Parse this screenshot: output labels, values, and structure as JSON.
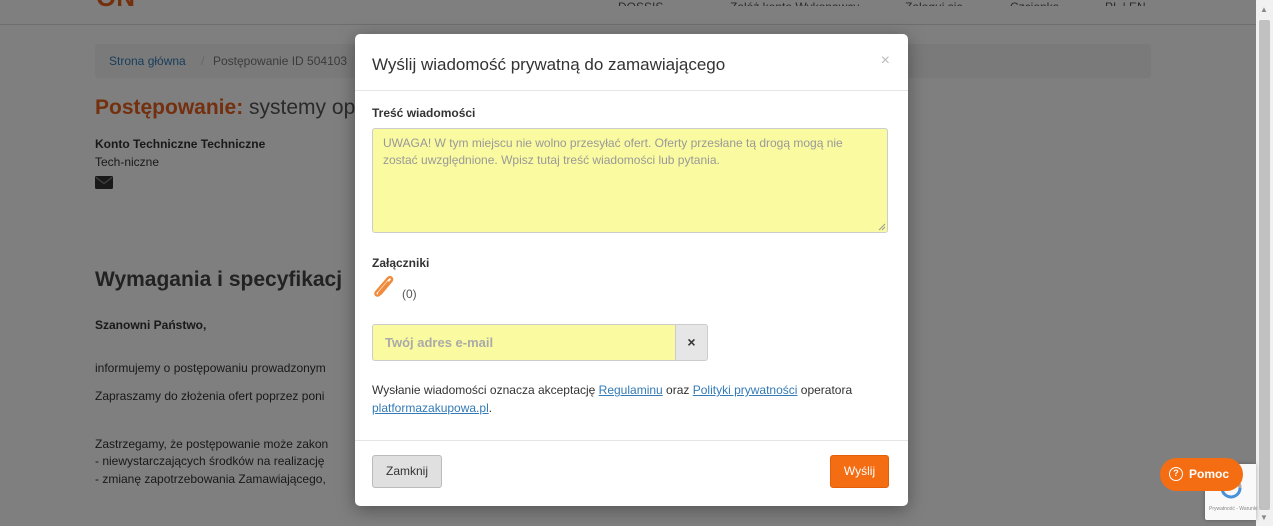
{
  "background": {
    "logo": "ON",
    "nav": [
      "DOSSIS",
      "Załóż konto Wykonawcy",
      "Zaloguj się",
      "Czcionka",
      "PL | EN"
    ],
    "breadcrumb": {
      "home": "Strona główna",
      "separator": "/",
      "current": "Postępowanie ID 504103"
    },
    "title_label": "Postępowanie:",
    "title_value": "systemy op",
    "account_name": "Konto Techniczne Techniczne",
    "account_sub": "Tech-niczne",
    "requirements_heading": "Wymagania i specyfikacj",
    "greeting": "Szanowni Państwo,",
    "para1": "informujemy o postępowaniu prowadzonym",
    "para2": "Zapraszamy do złożenia ofert poprzez poni",
    "para3": "Zastrzegamy, że postępowanie może zakon",
    "bullet1": "- niewystarczających środków na realizację",
    "bullet2": "- zmianę zapotrzebowania Zamawiającego,"
  },
  "modal": {
    "title": "Wyślij wiadomość prywatną do zamawiającego",
    "close_symbol": "×",
    "message_label": "Treść wiadomości",
    "message_placeholder": "UWAGA! W tym miejscu nie wolno przesyłać ofert. Oferty przesłane tą drogą mogą nie zostać uwzględnione. Wpisz tutaj treść wiadomości lub pytania.",
    "attachments_label": "Załączniki",
    "attachments_count": "(0)",
    "email_placeholder": "Twój adres e-mail",
    "email_clear": "×",
    "accept_prefix": "Wysłanie wiadomości oznacza akceptację ",
    "regulations_link": "Regulaminu",
    "accept_middle": " oraz ",
    "privacy_link": "Polityki prywatności",
    "operator_prefix": " operatora ",
    "operator_link": "platformazakupowa.pl",
    "operator_suffix": ".",
    "close_button": "Zamknij",
    "send_button": "Wyślij"
  },
  "help": {
    "label": "Pomoc",
    "icon": "?"
  },
  "recaptcha": {
    "text": "Prywatność - Warunki"
  },
  "colors": {
    "accent": "#f46d12",
    "field_bg": "#fafaa0",
    "link": "#337ab7",
    "backdrop": "rgba(0,0,0,0.5)"
  }
}
